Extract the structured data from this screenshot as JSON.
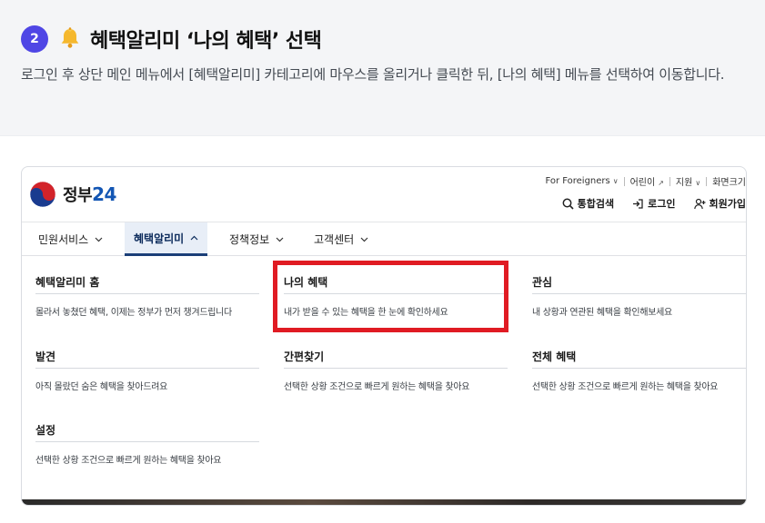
{
  "step": {
    "number": "2",
    "title": "혜택알리미 ‘나의 혜택’ 선택",
    "description": "로그인 후 상단 메인 메뉴에서 [혜택알리미] 카테고리에 마우스를 올리거나 클릭한 뒤, [나의 혜택] 메뉴를 선택하여 이동합니다.",
    "icon": "bell-icon"
  },
  "site": {
    "logo_text": "정부",
    "logo_num": "24",
    "util_links": [
      "For Foreigners",
      "어린이",
      "지원",
      "화면크기"
    ],
    "top_buttons": [
      "통합검색",
      "로그인",
      "회원가입"
    ]
  },
  "nav": {
    "items": [
      "민원서비스",
      "혜택알리미",
      "정책정보",
      "고객센터"
    ],
    "active": "혜택알리미"
  },
  "menu": {
    "columns": [
      {
        "title": "혜택알리미 홈",
        "desc": "몰라서 놓쳤던 혜택, 이제는 정부가 먼저 챙겨드립니다"
      },
      {
        "title": "나의 혜택",
        "desc": "내가 받을 수 있는 혜택을 한 눈에 확인하세요"
      },
      {
        "title": "관심",
        "desc": "내 상황과 연관된 혜택을 확인해보세요"
      },
      {
        "title": "발견",
        "desc": "아직 몰랐던 숨은 혜택을 찾아드려요"
      },
      {
        "title": "간편찾기",
        "desc": "선택한 상황 조건으로 빠르게 원하는 혜택을 찾아요"
      },
      {
        "title": "전체 혜택",
        "desc": "선택한 상황 조건으로 빠르게 원하는 혜택을 찾아요"
      },
      {
        "title": "설정",
        "desc": "선택한 상황 조건으로 빠르게 원하는 혜택을 찾아요"
      }
    ]
  },
  "colors": {
    "badge": "#4f46e5",
    "highlight": "#e01b23",
    "nav_active": "#1b3f78"
  }
}
